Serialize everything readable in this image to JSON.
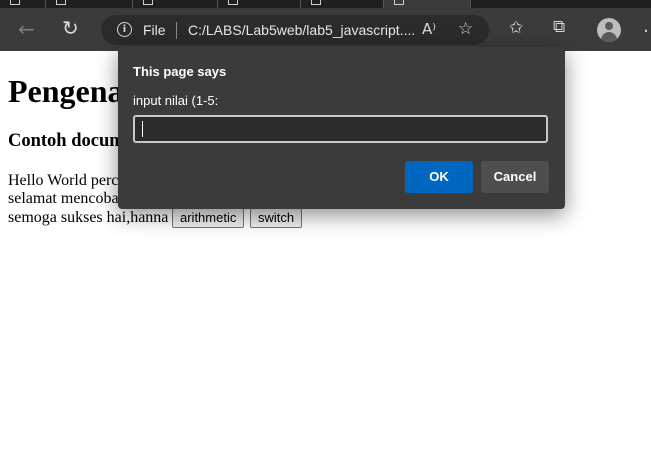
{
  "browser": {
    "address_scheme": "File",
    "address_url": "C:/LABS/Lab5web/lab5_javascript....",
    "icons": {
      "back": "back-arrow-icon",
      "refresh": "refresh-icon",
      "info": "info-icon",
      "read_aloud": "read-aloud-icon",
      "add_favorite": "add-favorite-icon",
      "favorites": "favorites-icon",
      "collections": "collections-icon",
      "profile": "profile-avatar-icon"
    }
  },
  "page": {
    "heading": "Pengena",
    "subheading": "Contoh docum",
    "lines": [
      "Hello World perc",
      "selamat mencoba",
      "semoga sukses hai,hanna"
    ],
    "buttons": {
      "arithmetic": "arithmetic",
      "switch": "switch"
    }
  },
  "dialog": {
    "title": "This page says",
    "message": "input nilai (1-5:",
    "input_value": "",
    "ok_label": "OK",
    "cancel_label": "Cancel"
  },
  "colors": {
    "chrome_dark": "#3b3b3b",
    "address_bg": "#2b2b2b",
    "ok_button": "#0067c0",
    "cancel_button": "#4e4e4e"
  }
}
